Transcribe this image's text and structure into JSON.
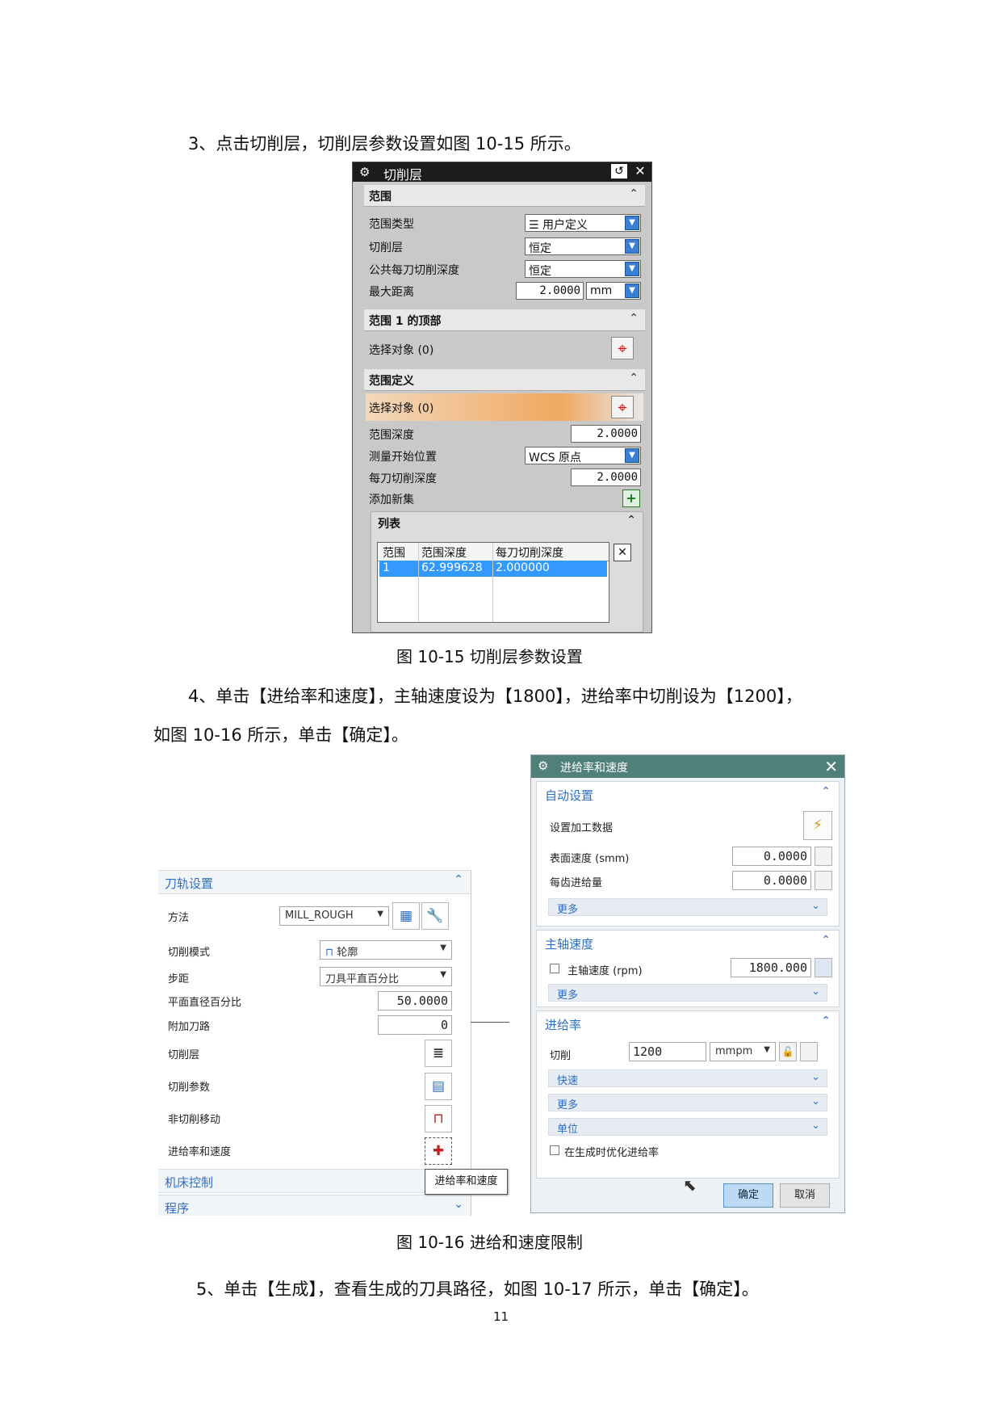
{
  "text": {
    "step3": "3、点击切削层，切削层参数设置如图 10-15 所示。",
    "caption1": "图 10-15    切削层参数设置",
    "step4_line1": "4、单击【进给率和速度】，主轴速度设为【1800】，进给率中切削设为【1200】，",
    "step4_line2": "如图 10-16 所示，单击【确定】。",
    "caption2": "图 10-16 进给和速度限制",
    "step5": "5、单击【生成】，查看生成的刀具路径，如图 10-17 所示，单击【确定】。",
    "page_number": "11"
  },
  "fig1": {
    "title": "切削层",
    "sec_range": "范围",
    "range_type_label": "范围类型",
    "range_type_value": "用户定义",
    "cut_levels_label": "切削层",
    "cut_levels_value": "恒定",
    "common_depth_label": "公共每刀切削深度",
    "common_depth_value": "恒定",
    "max_dist_label": "最大距离",
    "max_dist_value": "2.0000",
    "max_dist_unit": "mm",
    "sec_top": "范围 1 的顶部",
    "select_obj": "选择对象 (0)",
    "sec_def": "范围定义",
    "select_obj2": "选择对象 (0)",
    "range_depth_label": "范围深度",
    "range_depth_value": "2.0000",
    "measure_label": "测量开始位置",
    "measure_value": "WCS 原点",
    "per_cut_label": "每刀切削深度",
    "per_cut_value": "2.0000",
    "add_set_label": "添加新集",
    "list_label": "列表",
    "list_headers": [
      "范围",
      "范围深度",
      "每刀切削深度"
    ],
    "list_row": [
      "1",
      "62.999628",
      "2.000000"
    ]
  },
  "fig2_left": {
    "sec_path": "刀轨设置",
    "method_label": "方法",
    "method_value": "MILL_ROUGH",
    "cut_mode_label": "切削模式",
    "cut_mode_value": "轮廓",
    "stepover_label": "步距",
    "stepover_value": "刀具平直百分比",
    "flat_pct_label": "平面直径百分比",
    "flat_pct_value": "50.0000",
    "extra_path_label": "附加刀路",
    "extra_path_value": "0",
    "cut_levels_label": "切削层",
    "cut_params_label": "切削参数",
    "non_cut_label": "非切削移动",
    "feeds_label": "进给率和速度",
    "tooltip": "进给率和速度",
    "sec_machine": "机床控制",
    "sec_program": "程序"
  },
  "fig2_right": {
    "title": "进给率和速度",
    "sec_auto": "自动设置",
    "set_data_label": "设置加工数据",
    "surface_speed_label": "表面速度 (smm)",
    "surface_speed_value": "0.0000",
    "feed_per_tooth_label": "每齿进给量",
    "feed_per_tooth_value": "0.0000",
    "more": "更多",
    "sec_spindle": "主轴速度",
    "spindle_label": "主轴速度 (rpm)",
    "spindle_value": "1800.000",
    "sec_feed": "进给率",
    "cut_label": "切削",
    "cut_value": "1200",
    "cut_unit": "mmpm",
    "rapid": "快速",
    "unit": "单位",
    "optimize_label": "在生成时优化进给率",
    "ok": "确定",
    "cancel": "取消"
  },
  "icons": [
    "gear-icon",
    "reset-icon",
    "close-icon",
    "chevron-up-icon",
    "chevron-down-icon",
    "dropdown-arrow-icon",
    "crosshair-icon",
    "add-icon",
    "delete-icon",
    "wrench-icon",
    "lightning-icon",
    "lock-icon",
    "calculator-icon",
    "cursor-icon"
  ],
  "colors": {
    "accent_blue": "#3b7fd4",
    "selection": "#3399ff",
    "nx_title_teal": "#51807a",
    "nx_link_blue": "#2e6ec2",
    "highlight_orange": "#f0a860"
  }
}
